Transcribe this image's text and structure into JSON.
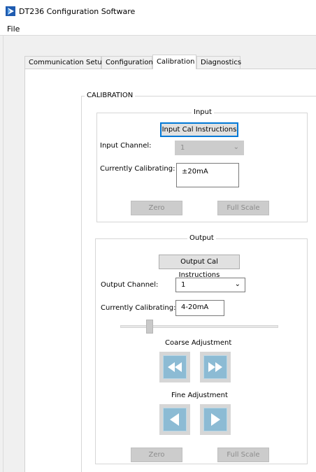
{
  "window": {
    "title": "DT236 Configuration Software",
    "app_icon": "play-arrow-logo-icon"
  },
  "menu": {
    "file": "File"
  },
  "tabs": [
    {
      "label": "Communication Setup"
    },
    {
      "label": "Configuration"
    },
    {
      "label": "Calibration",
      "active": true
    },
    {
      "label": "Diagnostics"
    }
  ],
  "calibration": {
    "group_label": "CALIBRATION",
    "input": {
      "group_label": "Input",
      "instructions_button": "Input Cal Instructions",
      "channel_label": "Input Channel:",
      "channel_value": "1",
      "calibrating_label": "Currently Calibrating:",
      "calibrating_value": "±20mA",
      "zero_button": "Zero",
      "full_scale_button": "Full Scale"
    },
    "output": {
      "group_label": "Output",
      "instructions_button": "Output Cal Instructions",
      "channel_label": "Output Channel:",
      "channel_value": "1",
      "calibrating_label": "Currently Calibrating:",
      "calibrating_value": "4-20mA",
      "slider_level": 0.17,
      "coarse_label": "Coarse Adjustment",
      "fine_label": "Fine Adjustment",
      "zero_button": "Zero",
      "full_scale_button": "Full Scale"
    }
  },
  "colors": {
    "accent": "#0078d7",
    "arrow_button": "#8cbbd4",
    "logo": "#1e5bb0"
  }
}
